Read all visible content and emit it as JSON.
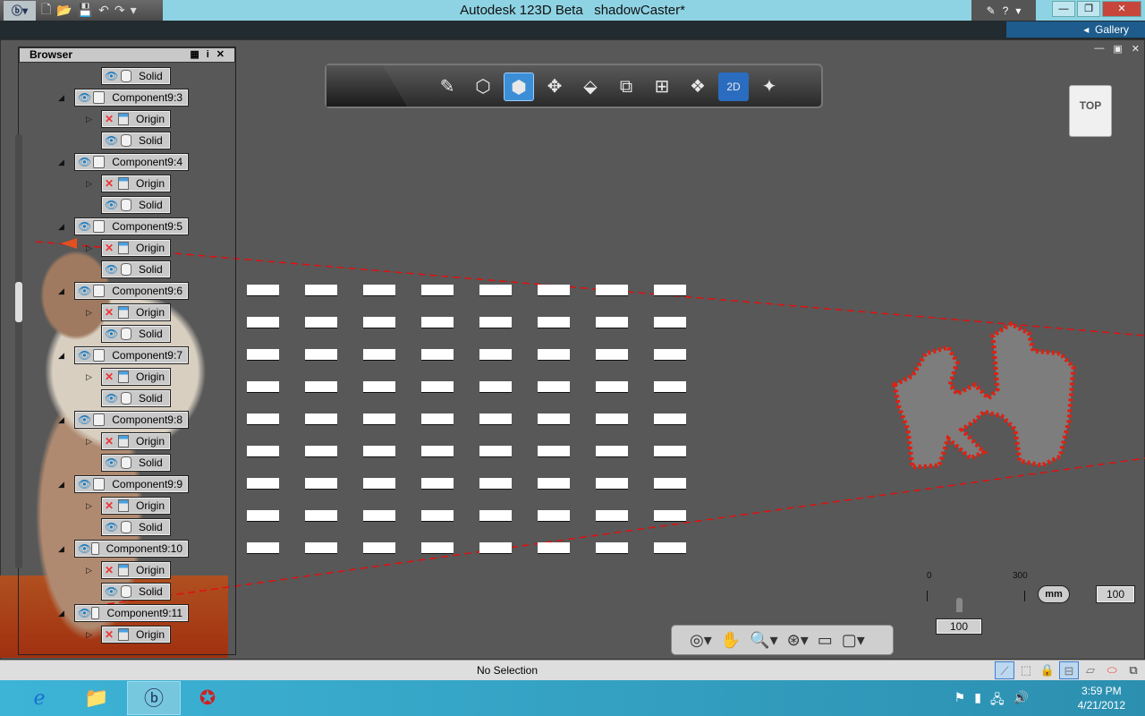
{
  "titlebar": {
    "app": "Autodesk 123D Beta",
    "document": "shadowCaster*",
    "help": "?"
  },
  "qat": {
    "icons": [
      "app-menu-icon",
      "new-icon",
      "open-icon",
      "save-icon",
      "undo-icon",
      "redo-icon",
      "customize-icon"
    ]
  },
  "gallery": {
    "label": "Gallery"
  },
  "browser": {
    "title": "Browser",
    "rows": [
      {
        "type": "solid",
        "label": "Solid",
        "indent": 1
      },
      {
        "type": "component",
        "label": "Component9:3"
      },
      {
        "type": "origin",
        "label": "Origin"
      },
      {
        "type": "solid",
        "label": "Solid"
      },
      {
        "type": "component",
        "label": "Component9:4"
      },
      {
        "type": "origin",
        "label": "Origin"
      },
      {
        "type": "solid",
        "label": "Solid"
      },
      {
        "type": "component",
        "label": "Component9:5"
      },
      {
        "type": "origin",
        "label": "Origin"
      },
      {
        "type": "solid",
        "label": "Solid"
      },
      {
        "type": "component",
        "label": "Component9:6"
      },
      {
        "type": "origin",
        "label": "Origin"
      },
      {
        "type": "solid",
        "label": "Solid"
      },
      {
        "type": "component",
        "label": "Component9:7"
      },
      {
        "type": "origin",
        "label": "Origin"
      },
      {
        "type": "solid",
        "label": "Solid"
      },
      {
        "type": "component",
        "label": "Component9:8"
      },
      {
        "type": "origin",
        "label": "Origin"
      },
      {
        "type": "solid",
        "label": "Solid"
      },
      {
        "type": "component",
        "label": "Component9:9"
      },
      {
        "type": "origin",
        "label": "Origin"
      },
      {
        "type": "solid",
        "label": "Solid"
      },
      {
        "type": "component",
        "label": "Component9:10"
      },
      {
        "type": "origin",
        "label": "Origin"
      },
      {
        "type": "solid",
        "label": "Solid"
      },
      {
        "type": "component",
        "label": "Component9:11"
      },
      {
        "type": "origin",
        "label": "Origin"
      }
    ]
  },
  "toolbar": {
    "tools": [
      "transform-icon",
      "sketch-icon",
      "primitives-icon",
      "construct-icon",
      "modify-icon",
      "pattern-icon",
      "grouping-icon",
      "combine-icon",
      "measure-icon",
      "text-2d-icon",
      "snap-icon"
    ],
    "active": "construct-icon"
  },
  "viewcube": {
    "face": "TOP"
  },
  "scale": {
    "min": "0",
    "max": "300",
    "slider_value": "100",
    "unit": "mm",
    "value": "100"
  },
  "status": {
    "text": "No Selection"
  },
  "taskbar": {
    "time": "3:59 PM",
    "date": "4/21/2012"
  }
}
